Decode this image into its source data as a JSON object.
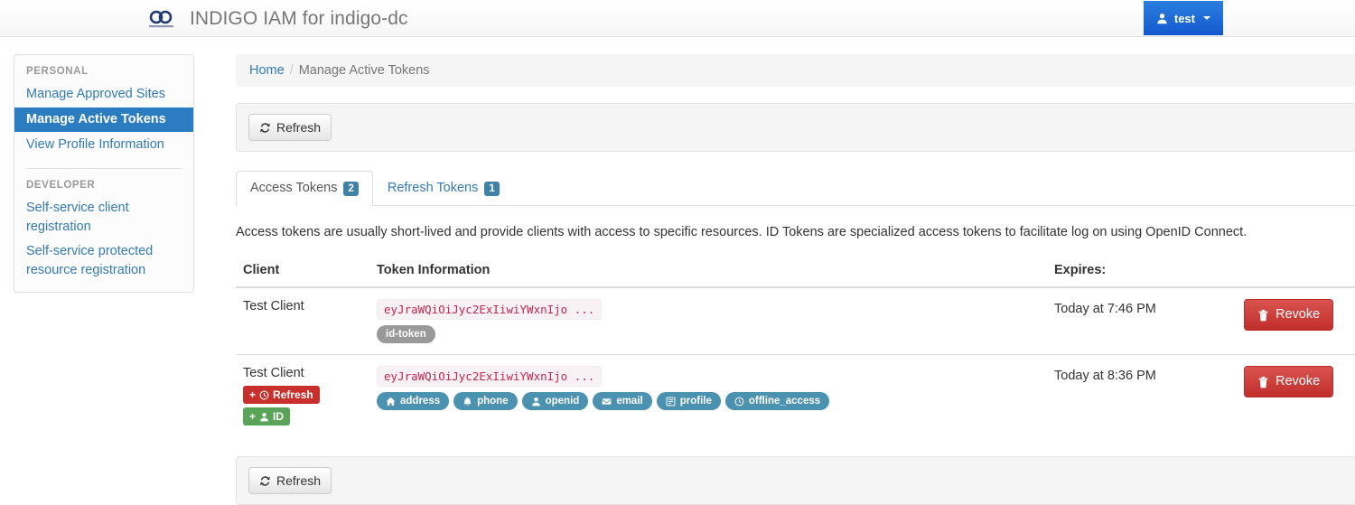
{
  "navbar": {
    "brand_title": "INDIGO IAM for indigo-dc",
    "logo_icon": "indigo-infinity-logo",
    "user_menu": {
      "label": "test",
      "icon": "user-icon",
      "caret_icon": "caret-down-icon"
    }
  },
  "sidebar": {
    "sections": [
      {
        "heading": "PERSONAL",
        "items": [
          {
            "label": "Manage Approved Sites",
            "active": false
          },
          {
            "label": "Manage Active Tokens",
            "active": true
          },
          {
            "label": "View Profile Information",
            "active": false
          }
        ]
      },
      {
        "heading": "DEVELOPER",
        "items": [
          {
            "label": "Self-service client registration",
            "active": false
          },
          {
            "label": "Self-service protected resource registration",
            "active": false
          }
        ]
      }
    ]
  },
  "breadcrumb": {
    "home": "Home",
    "separator": "/",
    "current": "Manage Active Tokens"
  },
  "toolbar_top": {
    "refresh_label": "Refresh",
    "refresh_icon": "refresh-icon"
  },
  "toolbar_bottom": {
    "refresh_label": "Refresh",
    "refresh_icon": "refresh-icon"
  },
  "tabs": [
    {
      "label": "Access Tokens",
      "count": "2",
      "active": true
    },
    {
      "label": "Refresh Tokens",
      "count": "1",
      "active": false
    }
  ],
  "tab_description": "Access tokens are usually short-lived and provide clients with access to specific resources. ID Tokens are specialized access tokens to facilitate log on using OpenID Connect.",
  "table": {
    "headers": {
      "client": "Client",
      "token_information": "Token Information",
      "expires": "Expires:",
      "action": ""
    },
    "rows": [
      {
        "client": "Test Client",
        "token": "eyJraWQiOiJyc2ExIiwiYWxnIjo ...",
        "id_token_label": "id-token",
        "scopes": [],
        "mini_labels": [],
        "expires": "Today at 7:46 PM",
        "revoke_label": "Revoke",
        "revoke_icon": "trash-icon"
      },
      {
        "client": "Test Client",
        "token": "eyJraWQiOiJyc2ExIiwiYWxnIjo ...",
        "id_token_label": "",
        "scopes": [
          {
            "label": "address",
            "icon": "home-icon"
          },
          {
            "label": "phone",
            "icon": "bell-icon"
          },
          {
            "label": "openid",
            "icon": "user-icon"
          },
          {
            "label": "email",
            "icon": "envelope-icon"
          },
          {
            "label": "profile",
            "icon": "list-icon"
          },
          {
            "label": "offline_access",
            "icon": "clock-icon"
          }
        ],
        "mini_labels": [
          {
            "text": "Refresh",
            "plus": "+",
            "icon": "clock-icon",
            "style": "danger"
          },
          {
            "text": "ID",
            "plus": "+",
            "icon": "user-icon",
            "style": "success"
          }
        ],
        "expires": "Today at 8:36 PM",
        "revoke_label": "Revoke",
        "revoke_icon": "trash-icon"
      }
    ]
  },
  "colors": {
    "accent_blue": "#2b7cc0",
    "link_blue": "#337ab7",
    "badge_blue": "#3e82a8",
    "scope_blue": "#4b91b0",
    "danger_red": "#c9302c",
    "success_green": "#5aa45a",
    "code_pink": "#c7254e"
  }
}
